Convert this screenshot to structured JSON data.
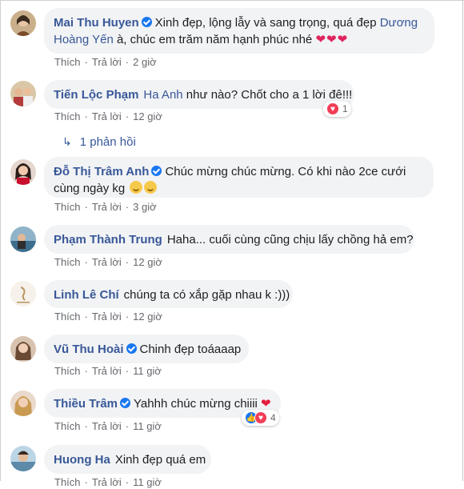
{
  "comments": [
    {
      "author": "Mai Thu Huyen",
      "text": "Xinh đẹp, lộng lẫy và sang trọng, quá đẹp ",
      "mention": "Dương Hoàng Yến",
      "text2": " à, chúc em trăm năm hạnh phúc nhé ",
      "hearts": "❤❤❤",
      "like": "Thích",
      "reply": "Trả lời",
      "time": "2 giờ"
    },
    {
      "author": "Tiến Lộc Phạm",
      "mention": "Ha Anh",
      "text": " như nào? Chốt cho a 1 lời đê!!!",
      "like": "Thích",
      "reply": "Trả lời",
      "time": "12 giờ",
      "reaction_count": "1"
    },
    {
      "author": "Đỗ Thị Trâm Anh",
      "text": "Chúc mừng chúc mừng. Có khi nào 2ce cưới cùng ngày kg",
      "like": "Thích",
      "reply": "Trả lời",
      "time": "3 giờ"
    },
    {
      "author": "Phạm Thành Trung",
      "text": "Haha... cuối cùng cũng chịu lấy chồng hả em?",
      "like": "Thích",
      "reply": "Trả lời",
      "time": "12 giờ"
    },
    {
      "author": "Linh Lê Chí",
      "text": "chúng ta có xắp gặp nhau k :)))",
      "like": "Thích",
      "reply": "Trả lời",
      "time": "12 giờ"
    },
    {
      "author": "Vũ Thu Hoài",
      "text": "Chinh đẹp toáaaap",
      "like": "Thích",
      "reply": "Trả lời",
      "time": "11 giờ"
    },
    {
      "author": "Thiều Trâm",
      "text": "Yahhh chúc mừng chiiii ",
      "heart": "❤",
      "like": "Thích",
      "reply": "Trả lời",
      "time": "11 giờ",
      "reaction_count": "4"
    },
    {
      "author": "Huong Ha",
      "text": "Xinh đẹp quá em",
      "like": "Thích",
      "reply": "Trả lời",
      "time": "11 giờ"
    }
  ],
  "replies_label": "1 phản hồi",
  "colors": {
    "link": "#385898",
    "bubble": "#f2f3f5",
    "meta": "#65676b",
    "verified": "#1877f2"
  }
}
